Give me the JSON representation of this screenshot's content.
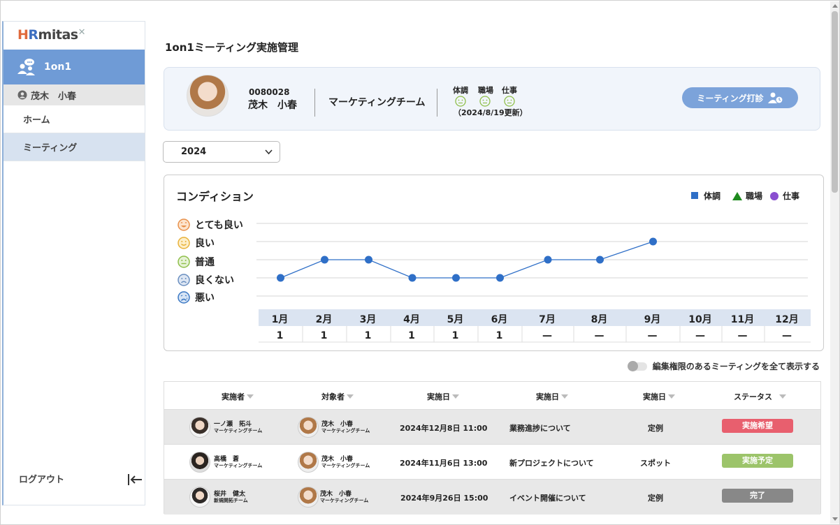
{
  "app": {
    "logo_prefix_h": "H",
    "logo_prefix_r": "R",
    "logo_text": "mitas"
  },
  "sidebar": {
    "section_label": "1on1",
    "user_name": "茂木　小春",
    "items": [
      {
        "label": "ホーム"
      },
      {
        "label": "ミーティング"
      }
    ],
    "logout_label": "ログアウト"
  },
  "page_title": "1on1ミーティング実施管理",
  "profile": {
    "employee_id": "0080028",
    "name": "茂木　小春",
    "team": "マーケティングチーム",
    "condition_headers": [
      "体調",
      "職場",
      "仕事"
    ],
    "updated": "（2024/8/19更新）",
    "meeting_button": "ミーティング打診"
  },
  "year_select": {
    "value": "2024"
  },
  "condition_chart": {
    "title": "コンディション",
    "legend": [
      {
        "label": "体調",
        "color": "#2f6fc7",
        "shape": "square"
      },
      {
        "label": "職場",
        "color": "#1e8a1e",
        "shape": "triangle"
      },
      {
        "label": "仕事",
        "color": "#8a4fd0",
        "shape": "circle"
      }
    ],
    "levels": [
      {
        "label": "とても良い",
        "icon": "very-happy-face-icon",
        "color": "#e8904a"
      },
      {
        "label": "良い",
        "icon": "happy-face-icon",
        "color": "#e8b23a"
      },
      {
        "label": "普通",
        "icon": "neutral-face-icon",
        "color": "#8fbf4a"
      },
      {
        "label": "良くない",
        "icon": "sad-face-icon",
        "color": "#6a8fc0"
      },
      {
        "label": "悪い",
        "icon": "very-sad-face-icon",
        "color": "#3b78c4"
      }
    ]
  },
  "chart_data": {
    "type": "line",
    "categories": [
      "1月",
      "2月",
      "3月",
      "4月",
      "5月",
      "6月",
      "7月",
      "8月",
      "9月",
      "10月",
      "11月",
      "12月"
    ],
    "y_levels": [
      "悪い",
      "良くない",
      "普通",
      "良い",
      "とても良い"
    ],
    "ylim": [
      1,
      5
    ],
    "series": [
      {
        "name": "体調",
        "color": "#2f6fc7",
        "values": [
          2,
          3,
          3,
          2,
          2,
          2,
          3,
          3,
          4,
          null,
          null,
          null
        ]
      }
    ],
    "counts": [
      "1",
      "1",
      "1",
      "1",
      "1",
      "1",
      "—",
      "—",
      "—",
      "—",
      "—",
      "—"
    ],
    "grid": true,
    "legend_position": "top-right"
  },
  "toggle": {
    "label": "編集権限のあるミーティングを全て表示する",
    "on": false
  },
  "table": {
    "headers": [
      "実施者",
      "対象者",
      "実施日",
      "実施日",
      "実施日",
      "ステータス"
    ],
    "rows": [
      {
        "host_name": "一ノ瀬　拓斗",
        "host_team": "マーケティングチーム",
        "target_name": "茂木　小春",
        "target_team": "マーケティングチーム",
        "date": "2024年12月8日 11:00",
        "topic": "業務進捗について",
        "type": "定例",
        "status": "実施希望",
        "status_color": "#e85f6e"
      },
      {
        "host_name": "高橋　蒼",
        "host_team": "マーケティングチーム",
        "target_name": "茂木　小春",
        "target_team": "マーケティングチーム",
        "date": "2024年11月6日 13:00",
        "topic": "新プロジェクトについて",
        "type": "スポット",
        "status": "実施予定",
        "status_color": "#9cc46a"
      },
      {
        "host_name": "桜井　健太",
        "host_team": "新規開拓チーム",
        "target_name": "茂木　小春",
        "target_team": "マーケティングチーム",
        "date": "2024年9月26日 15:00",
        "topic": "イベント開催について",
        "type": "定例",
        "status": "完了",
        "status_color": "#888888"
      }
    ]
  }
}
